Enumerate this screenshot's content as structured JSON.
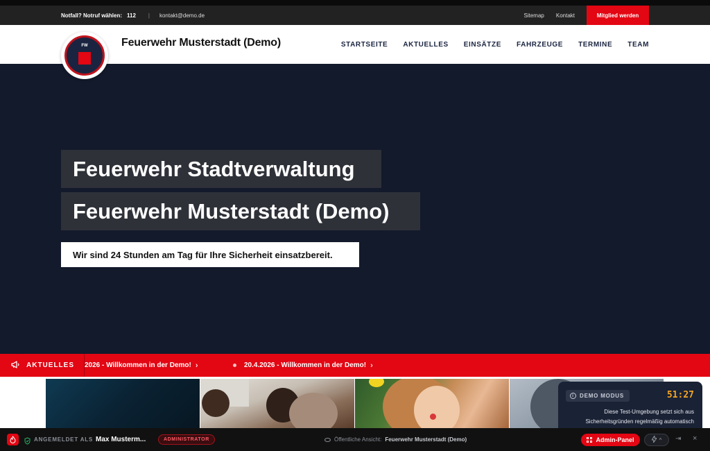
{
  "utility_bar": {
    "emergency_label": "Notfall? Notruf wählen:",
    "emergency_number": "112",
    "separator": "|",
    "email": "kontakt@demo.de",
    "links": [
      "Sitemap",
      "Kontakt"
    ],
    "cta": "Mitglied werden"
  },
  "header": {
    "logo_text": "FW",
    "site_title": "Feuerwehr Musterstadt (Demo)",
    "nav": [
      "STARTSEITE",
      "AKTUELLES",
      "EINSÄTZE",
      "FAHRZEUGE",
      "TERMINE",
      "TEAM"
    ]
  },
  "hero": {
    "title_line1": "Feuerwehr Stadtverwaltung",
    "title_line2": "Feuerwehr Musterstadt (Demo)",
    "subtitle": "Wir sind 24 Stunden am Tag für Ihre Sicherheit einsatzbereit."
  },
  "ticker": {
    "label": "AKTUELLES",
    "items": [
      "2026 - Willkommen in der Demo!",
      "20.4.2026 - Willkommen in der Demo!"
    ],
    "arrow": "›"
  },
  "demo_mode": {
    "badge": "DEMO MODUS",
    "timer": "51:27",
    "text": "Diese Test-Umgebung setzt sich aus Sicherheitsgründen regelmäßig automatisch"
  },
  "admin_bar": {
    "logged_in_label": "ANGEMELDET ALS",
    "user_name": "Max Musterm...",
    "role": "ADMINISTRATOR",
    "public_view_label": "Öffentliche Ansicht:",
    "public_view_site": "Feuerwehr Musterstadt (Demo)",
    "admin_panel_label": "Admin-Panel",
    "bolt_chevron": "^",
    "logout_symbol": "⇥",
    "close_symbol": "×"
  },
  "colors": {
    "accent_red": "#e30613",
    "hero_bg": "#131a2b",
    "timer_orange": "#f5a524"
  },
  "icons": [
    "fire-icon",
    "shield-check-icon",
    "eye-icon",
    "grid-icon",
    "bolt-icon",
    "logout-icon",
    "close-icon",
    "megaphone-icon",
    "info-icon"
  ]
}
